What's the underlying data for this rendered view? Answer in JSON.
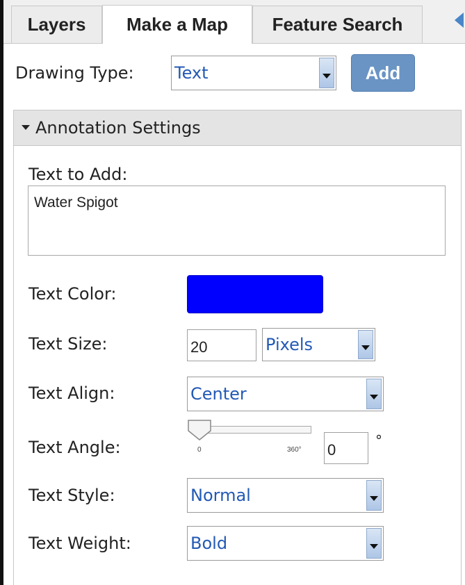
{
  "tabs": [
    {
      "label": "Layers",
      "active": false
    },
    {
      "label": "Make a Map",
      "active": true
    },
    {
      "label": "Feature Search",
      "active": false
    }
  ],
  "drawing_type": {
    "label": "Drawing Type:",
    "value": "Text",
    "add_label": "Add"
  },
  "annotation": {
    "header": "Annotation Settings",
    "text_to_add_label": "Text to Add:",
    "text_to_add_value": "Water Spigot",
    "color_label": "Text Color:",
    "color_value": "#0000ff",
    "size_label": "Text Size:",
    "size_value": "20",
    "size_unit": "Pixels",
    "align_label": "Text Align:",
    "align_value": "Center",
    "angle_label": "Text Angle:",
    "angle_min": "0",
    "angle_max": "360°",
    "angle_value": "0",
    "angle_unit": "°",
    "style_label": "Text Style:",
    "style_value": "Normal",
    "weight_label": "Text Weight:",
    "weight_value": "Bold"
  },
  "colors": {
    "accent": "#6a94c4",
    "select_text": "#2359b5"
  },
  "icons": {
    "collapse": "caret-down-icon",
    "tabs_scroll": "chevron-left-icon",
    "dropdown": "chevron-down-icon"
  }
}
